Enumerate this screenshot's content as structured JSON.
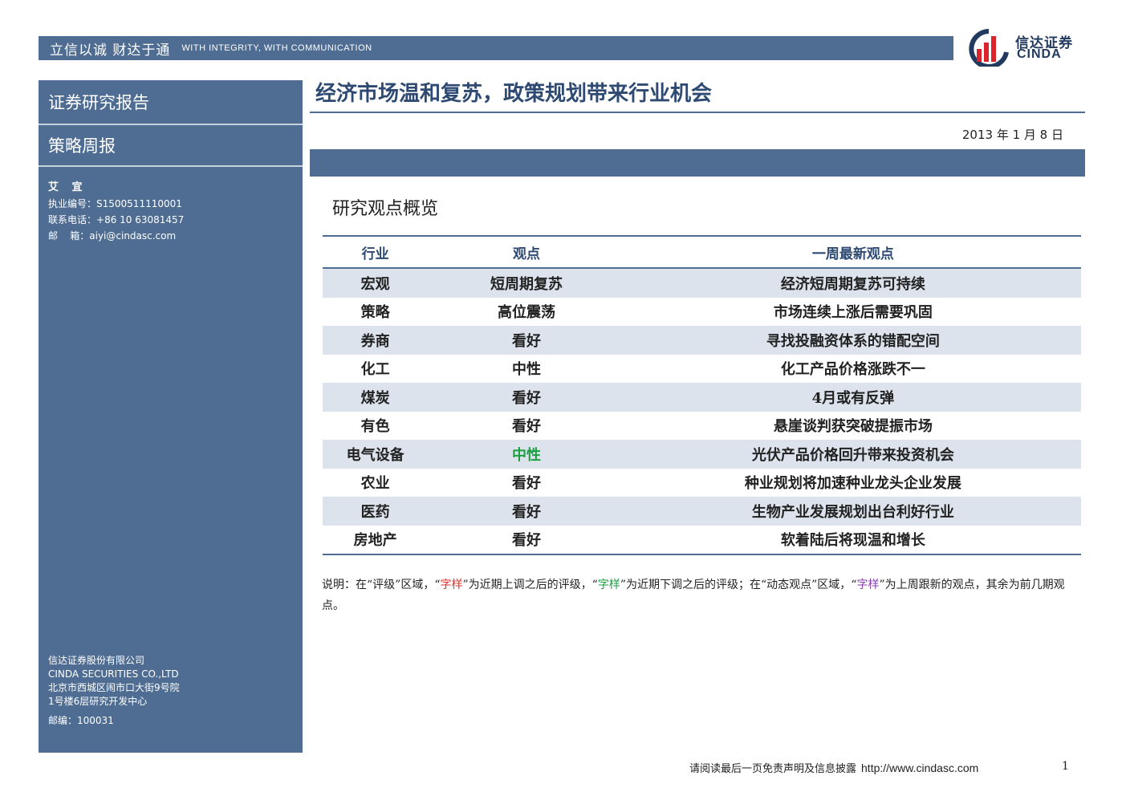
{
  "header": {
    "motto_cn": "立信以诚  财达于通",
    "motto_en": "WITH INTEGRITY, WITH COMMUNICATION",
    "logo_cn": "信达证券",
    "logo_en": "CINDA",
    "brand_color": "#4f6d92"
  },
  "sidebar": {
    "report_type": "证券研究报告",
    "report_sub": "策略周报",
    "analyst": {
      "name": "艾 宜",
      "license_label": "执业编号：",
      "license": "S1500511110001",
      "phone_label": "联系电话：",
      "phone": "+86 10 63081457",
      "email_label": "邮    箱：",
      "email": "aiyi@cindasc.com"
    },
    "company": {
      "name_cn": "信达证券股份有限公司",
      "name_en": "CINDA SECURITIES CO.,LTD",
      "address1": "北京市西城区闹市口大街9号院",
      "address2": "1号楼6层研究开发中心",
      "zip": "邮编：100031"
    }
  },
  "main": {
    "title": "经济市场温和复苏，政策规划带来行业机会",
    "date": "2013 年 1 月 8 日",
    "section_title": "研究观点概览",
    "table": {
      "headers": [
        "行业",
        "观点",
        "一周最新观点"
      ],
      "rows": [
        [
          "宏观",
          "短周期复苏",
          "经济短周期复苏可持续"
        ],
        [
          "策略",
          "高位震荡",
          "市场连续上涨后需要巩固"
        ],
        [
          "券商",
          "看好",
          "寻找投融资体系的错配空间"
        ],
        [
          "化工",
          "中性",
          "化工产品价格涨跌不一"
        ],
        [
          "煤炭",
          "看好",
          "4月或有反弹"
        ],
        [
          "有色",
          "看好",
          "悬崖谈判获突破提振市场"
        ],
        [
          "电气设备",
          "中性",
          "光伏产品价格回升带来投资机会"
        ],
        [
          "农业",
          "看好",
          "种业规划将加速种业龙头企业发展"
        ],
        [
          "医药",
          "看好",
          "生物产业发展规划出台利好行业"
        ],
        [
          "房地产",
          "看好",
          "软着陆后将现温和增长"
        ]
      ]
    },
    "note": {
      "p1": "说明：在“评级”区域，“",
      "red_word": "字样",
      "p2": "”为近期上调之后的评级，“",
      "green_word": "字样",
      "p3": "”为近期下调之后的评级；在“动态观点”区域，“",
      "purple_word": "字样",
      "p4": "”为上周跟新的观点，其余为前几期观点。"
    }
  },
  "footer": {
    "disclaimer": "请阅读最后一页免责声明及信息披露",
    "url": "http://www.cindasc.com",
    "page": "1"
  }
}
